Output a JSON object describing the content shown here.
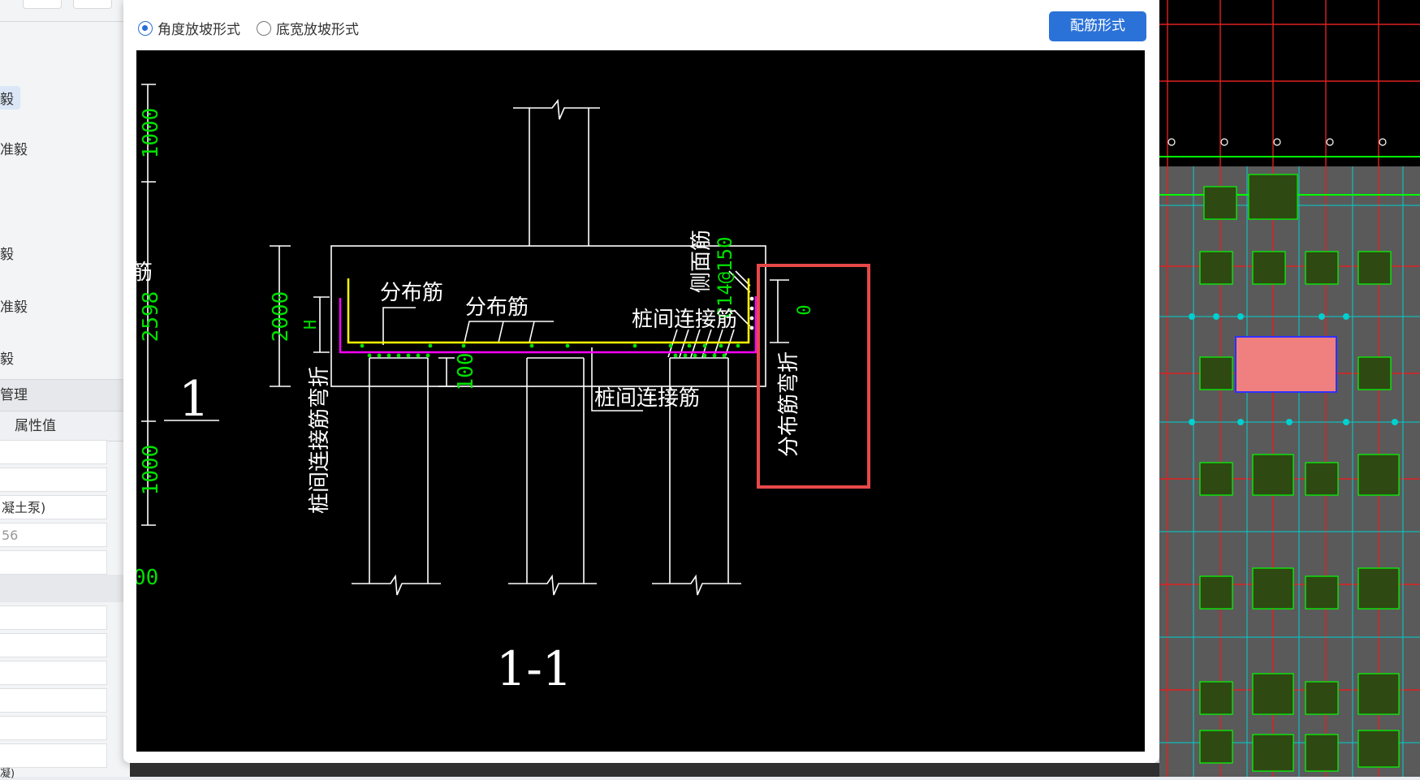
{
  "left_panel": {
    "items": [
      "毅",
      "准毅",
      "毅",
      "准毅",
      "毅"
    ],
    "section_title": "管理",
    "column_header": "属性值",
    "fields": [
      "",
      "",
      "凝土泵)",
      "56",
      ""
    ],
    "bottom_partial": "凝)"
  },
  "dialog": {
    "radio_angle": "角度放坡形式",
    "radio_width": "底宽放坡形式",
    "mode_button": "配筋形式"
  },
  "drawing": {
    "dims": {
      "top_1000": "1000",
      "total_2598": "2598",
      "bottom_1000": "1000",
      "cap_2000": "2000",
      "h_label": "H",
      "cover_100": "100",
      "edge_00": "00",
      "right_0": "0"
    },
    "labels": {
      "partial_jin": "筋",
      "section_mark": "1",
      "distribution_1": "分布筋",
      "distribution_2": "分布筋",
      "side_bar": "侧面筋",
      "side_spec": "C14@150",
      "pile_connect_1": "桩间连接筋",
      "pile_connect_2": "桩间连接筋",
      "pile_connect_bend": "桩间连接筋弯折",
      "dist_bend": "分布筋弯折",
      "section_title": "1-1"
    },
    "colors": {
      "line": "#ffffff",
      "dim": "#00e000",
      "rebar_top": "#ffff00",
      "rebar_bottom": "#ff00ff",
      "highlight_box": "#e84848"
    }
  }
}
